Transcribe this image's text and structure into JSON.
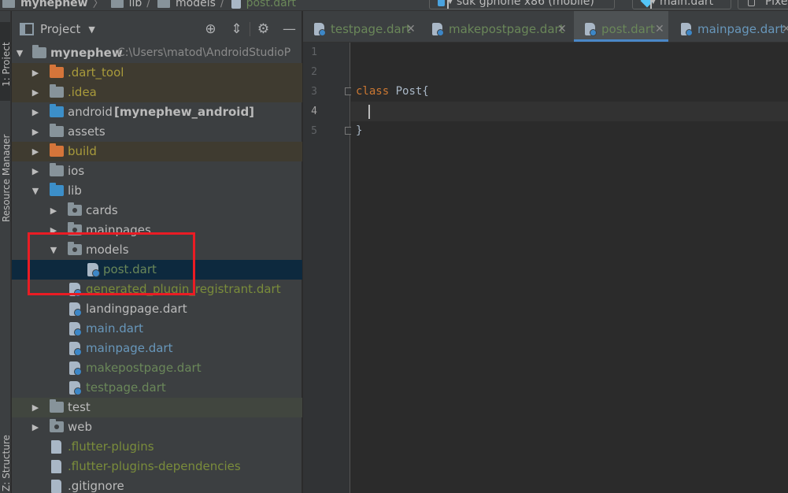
{
  "window": {
    "breadcrumbs": [
      "mynephew",
      "lib",
      "models",
      "post.dart"
    ],
    "device_selector": "sdk gphone x86 (mobile)",
    "run_config": "main.dart",
    "pixel_label": "Pixe"
  },
  "toolstrip": {
    "project_tab": "1: Project",
    "resource_tab": "Resource Manager",
    "structure_tab": "Z: Structure"
  },
  "project_panel": {
    "title": "Project",
    "root": {
      "name": "mynephew",
      "path": "C:\\Users\\matod\\AndroidStudioP"
    },
    "items": [
      {
        "label": ".dart_tool",
        "module": ""
      },
      {
        "label": ".idea",
        "module": ""
      },
      {
        "label": "android",
        "module": "[mynephew_android]"
      },
      {
        "label": "assets",
        "module": ""
      },
      {
        "label": "build",
        "module": ""
      },
      {
        "label": "ios",
        "module": ""
      },
      {
        "label": "lib",
        "module": ""
      },
      {
        "label": "cards",
        "module": ""
      },
      {
        "label": "mainpages",
        "module": ""
      },
      {
        "label": "models",
        "module": ""
      },
      {
        "label": "post.dart",
        "module": ""
      },
      {
        "label": "generated_plugin_registrant.dart",
        "module": ""
      },
      {
        "label": "landingpage.dart",
        "module": ""
      },
      {
        "label": "main.dart",
        "module": ""
      },
      {
        "label": "mainpage.dart",
        "module": ""
      },
      {
        "label": "makepostpage.dart",
        "module": ""
      },
      {
        "label": "testpage.dart",
        "module": ""
      },
      {
        "label": "test",
        "module": ""
      },
      {
        "label": "web",
        "module": ""
      },
      {
        "label": ".flutter-plugins",
        "module": ""
      },
      {
        "label": ".flutter-plugins-dependencies",
        "module": ""
      },
      {
        "label": ".gitignore",
        "module": ""
      }
    ]
  },
  "editor": {
    "tabs": [
      {
        "label": "testpage.dart",
        "active": false
      },
      {
        "label": "makepostpage.dart",
        "active": false
      },
      {
        "label": "post.dart",
        "active": true
      },
      {
        "label": "mainpage.dart",
        "active": false
      }
    ],
    "line_numbers": [
      "1",
      "2",
      "3",
      "4",
      "5"
    ],
    "lines": [
      {
        "keyword": "",
        "text": ""
      },
      {
        "keyword": "",
        "text": ""
      },
      {
        "keyword": "class",
        "text": " Post{"
      },
      {
        "keyword": "",
        "text": ""
      },
      {
        "keyword": "",
        "text": "}"
      }
    ]
  },
  "colors": {
    "selection_highlight": "#0d293e",
    "annotation_box": "#ea1c24",
    "active_tab_underline": "#4a88c7",
    "keyword": "#cc7832"
  }
}
